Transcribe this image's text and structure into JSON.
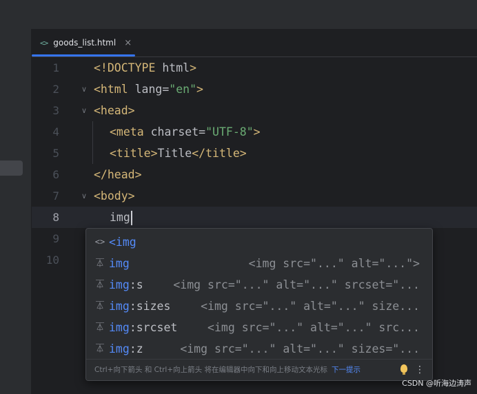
{
  "tab": {
    "icon": "<>",
    "label": "goods_list.html",
    "close": "×"
  },
  "editor": {
    "line_numbers": [
      "1",
      "2",
      "3",
      "4",
      "5",
      "6",
      "7",
      "8",
      "9",
      "10"
    ],
    "current_line": "8",
    "typed": "img"
  },
  "code": {
    "l1": {
      "a": "<!DOCTYPE",
      "b": " html",
      "c": ">"
    },
    "l2": {
      "a": "<html",
      "attr": " lang",
      "eq": "=",
      "val": "\"en\"",
      "c": ">"
    },
    "l3": {
      "a": "<head>"
    },
    "l4": {
      "a": "<meta",
      "attr": " charset",
      "eq": "=",
      "val": "\"UTF-8\"",
      "c": ">"
    },
    "l5": {
      "a": "<title>",
      "text": "Title",
      "c": "</title>"
    },
    "l6": {
      "a": "</head>"
    },
    "l7": {
      "a": "<body>"
    }
  },
  "completion": {
    "items": [
      {
        "icon": "<>",
        "match": "<img",
        "rest": "",
        "tail": ""
      },
      {
        "icon": "template-icon",
        "match": "img",
        "rest": "",
        "tail": "<img src=\"...\" alt=\"...\">"
      },
      {
        "icon": "template-icon",
        "match": "img",
        "rest": ":s",
        "tail": "<img src=\"...\" alt=\"...\" srcset=\"..."
      },
      {
        "icon": "template-icon",
        "match": "img",
        "rest": ":sizes",
        "tail": "<img src=\"...\" alt=\"...\" size..."
      },
      {
        "icon": "template-icon",
        "match": "img",
        "rest": ":srcset",
        "tail": "<img src=\"...\" alt=\"...\" src..."
      },
      {
        "icon": "template-icon",
        "match": "img",
        "rest": ":z",
        "tail": "<img src=\"...\" alt=\"...\" sizes=\"..."
      }
    ],
    "hint_text": "Ctrl+向下箭头 和 Ctrl+向上箭头 将在编辑器中向下和向上移动文本光标",
    "hint_link": "下一提示",
    "more": "⋮"
  },
  "watermark": "CSDN @听海边涛声",
  "colors": {
    "accent": "#3574f0",
    "tag": "#d5b778",
    "string": "#6aab73",
    "match": "#548af7"
  }
}
